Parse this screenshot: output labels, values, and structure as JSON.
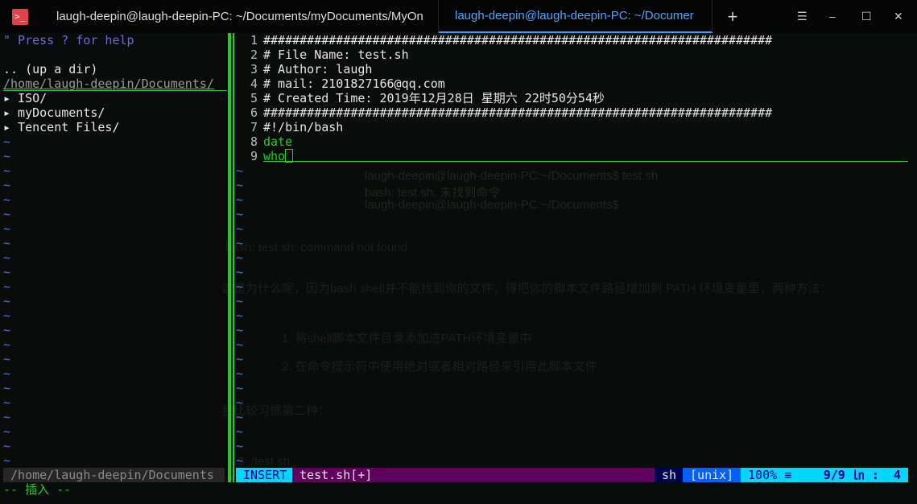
{
  "tabs": [
    {
      "label": "laugh-deepin@laugh-deepin-PC: ~/Documents/myDocuments/MyOn"
    },
    {
      "label": "laugh-deepin@laugh-deepin-PC: ~/Documer"
    }
  ],
  "window_controls": {
    "plus": "+",
    "menu": "☰",
    "minimize": "–",
    "maximize": "☐",
    "close": "✕"
  },
  "tree": {
    "help": "\" Press ? for help",
    "up": ".. (up a dir)",
    "cwd": "/home/laugh-deepin/Documents/",
    "items": [
      "▸ ISO/",
      "▸ myDocuments/",
      "▸ Tencent Files/"
    ]
  },
  "code": [
    "######################################################################",
    "# File Name: test.sh",
    "# Author: laugh",
    "# mail: 2101827166@qq.com",
    "# Created Time: 2019年12月28日 星期六 22时50分54秒",
    "######################################################################",
    "#!/bin/bash",
    "date",
    "who"
  ],
  "ghost": [
    "laugh-deepin@laugh-deepin-PC:~/Documents$ test.sh",
    "bash: test.sh: 未找到命令",
    "laugh-deepin@laugh-deepin-PC:~/Documents$",
    "bash: test.sh: command not found",
    "这是为什么呢，因为bash shell并不能找到你的文件，得把你的脚本文件路径增加到 PATH 环境变量里，两种方法：",
    "1. 将shell脚本文件目录添加进PATH环境变量中",
    "2. 在命令提示符中使用绝对或者相对路径来引用此脚本文件",
    "我比较习惯第二种：",
    "$ ./test.sh"
  ],
  "statusline": {
    "left_path": " /home/laugh-deepin/Documents ",
    "mode": " INSERT ",
    "file": " test.sh[+]",
    "filetype": " sh ",
    "format": " [unix] ",
    "percent": " 100% ≡ ",
    "position": "9/9 ㏑ :  4 "
  },
  "cmdline": "-- 插入 --",
  "colors": {
    "accent": "#22cc22",
    "tab_active": "#2ea0ff",
    "mode_bg": "#00d7ff",
    "file_bg": "#5f005f",
    "format_bg": "#005fff"
  }
}
